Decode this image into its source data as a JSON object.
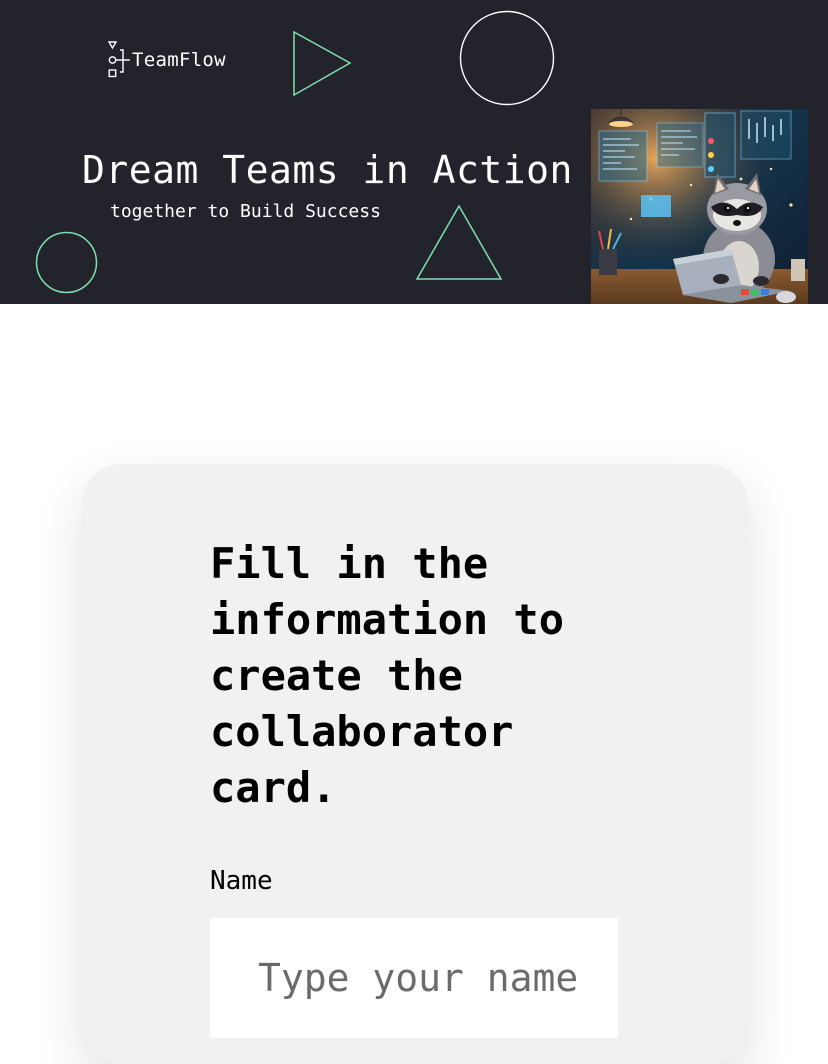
{
  "banner": {
    "logo_text": "TeamFlow",
    "title": "Dream Teams in Action",
    "subtitle": "together to Build Success",
    "accent_color": "#7ee0b0",
    "background_color": "#22232b",
    "hero_image_alt": "Raccoon coding at a laptop"
  },
  "form": {
    "title": "Fill in the information to create the collaborator card.",
    "fields": {
      "name": {
        "label": "Name",
        "placeholder": "Type your name",
        "value": ""
      }
    }
  },
  "icons": {
    "logo": "flow-diagram-icon"
  }
}
